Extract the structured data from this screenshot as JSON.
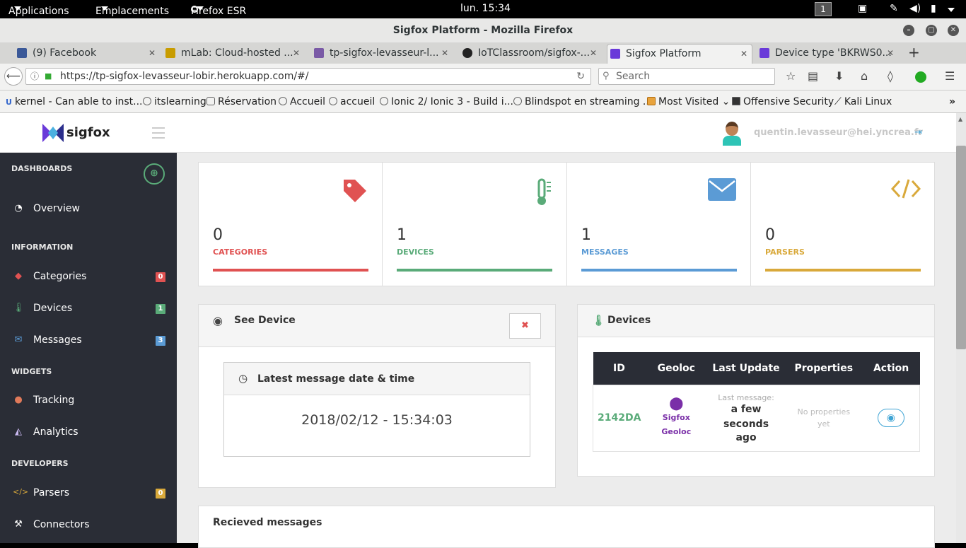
{
  "gnome": {
    "applications": "Applications",
    "places": "Emplacements",
    "firefox": "Firefox ESR",
    "clock": "lun. 15:34",
    "workspace": "1"
  },
  "window": {
    "title": "Sigfox Platform - Mozilla Firefox"
  },
  "tabs": [
    {
      "label": "(9) Facebook",
      "color": "#3b5998"
    },
    {
      "label": "mLab: Cloud-hosted ...",
      "color": "#c89c00"
    },
    {
      "label": "tp-sigfox-levasseur-l...",
      "color": "#7a5aa6"
    },
    {
      "label": "IoTClassroom/sigfox-...",
      "color": "#222222"
    },
    {
      "label": "Sigfox Platform",
      "color": "#6a3ad9"
    },
    {
      "label": "Device type 'BKRWS0...",
      "color": "#6a3ad9"
    }
  ],
  "nav": {
    "url": "https://tp-sigfox-levasseur-lobir.herokuapp.com/#/",
    "search_placeholder": "Search"
  },
  "bookmarks": [
    "kernel - Can able to inst...",
    "itslearning",
    "Réservation",
    "Accueil",
    "accueil",
    "Ionic 2/ Ionic 3 - Build i...",
    "Blindspot en streaming ...",
    "Most Visited",
    "Offensive Security",
    "Kali Linux"
  ],
  "app": {
    "brand": "sigfox",
    "user_email": "quentin.levasseur@hei.yncrea.fr"
  },
  "sidebar": {
    "sections": {
      "dashboards": "DASHBOARDS",
      "information": "INFORMATION",
      "widgets": "WIDGETS",
      "developers": "DEVELOPERS"
    },
    "items": {
      "overview": "Overview",
      "categories": "Categories",
      "devices": "Devices",
      "messages": "Messages",
      "tracking": "Tracking",
      "analytics": "Analytics",
      "parsers": "Parsers",
      "connectors": "Connectors"
    },
    "badges": {
      "categories": "0",
      "devices": "1",
      "messages": "3",
      "parsers": "0"
    }
  },
  "stats": [
    {
      "value": "0",
      "label": "CATEGORIES",
      "color": "#e05252"
    },
    {
      "value": "1",
      "label": "DEVICES",
      "color": "#5aab79"
    },
    {
      "value": "1",
      "label": "MESSAGES",
      "color": "#5b9bd5"
    },
    {
      "value": "0",
      "label": "PARSERS",
      "color": "#d9a93b"
    }
  ],
  "see_device": {
    "title": "See Device",
    "latest_title": "Latest message date & time",
    "latest_value": "2018/02/12 - 15:34:03"
  },
  "devices_panel": {
    "title": "Devices",
    "columns": [
      "ID",
      "Geoloc",
      "Last Update",
      "Properties",
      "Action"
    ],
    "row": {
      "id": "2142DA",
      "geoloc_line1": "Sigfox",
      "geoloc_line2": "Geoloc",
      "last_msg_label": "Last message:",
      "last_msg_value_1": "a few seconds",
      "last_msg_value_2": "ago",
      "props_1": "No properties",
      "props_2": "yet"
    }
  },
  "received": {
    "title": "Recieved messages"
  }
}
